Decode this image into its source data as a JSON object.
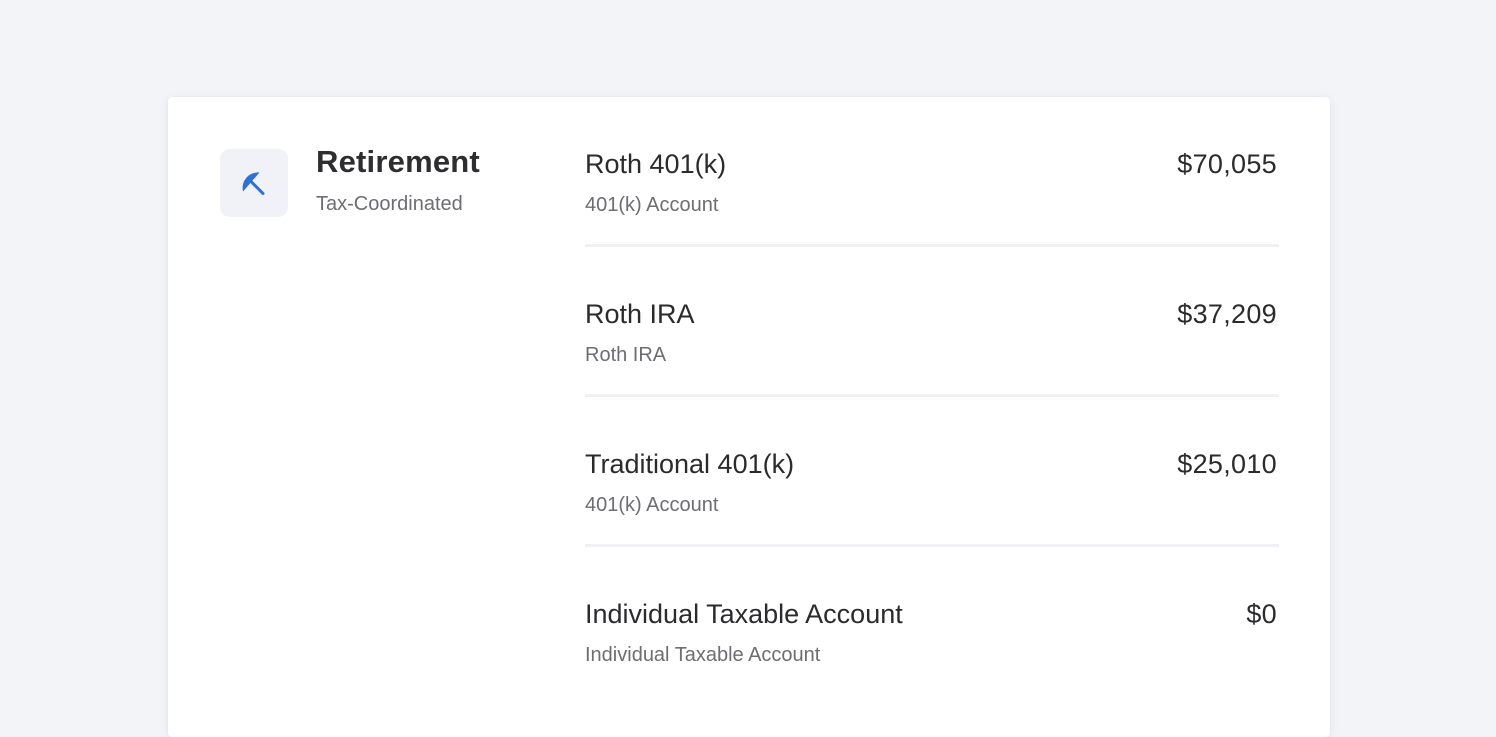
{
  "page_background": "#f3f4f8",
  "accent_color": "#2f6fd6",
  "group": {
    "icon": "umbrella-icon",
    "title": "Retirement",
    "subtitle": "Tax-Coordinated"
  },
  "accounts": [
    {
      "name": "Roth 401(k)",
      "type": "401(k) Account",
      "balance": "$70,055"
    },
    {
      "name": "Roth IRA",
      "type": "Roth IRA",
      "balance": "$37,209"
    },
    {
      "name": "Traditional 401(k)",
      "type": "401(k) Account",
      "balance": "$25,010"
    },
    {
      "name": "Individual Taxable Account",
      "type": "Individual Taxable Account",
      "balance": "$0"
    }
  ]
}
